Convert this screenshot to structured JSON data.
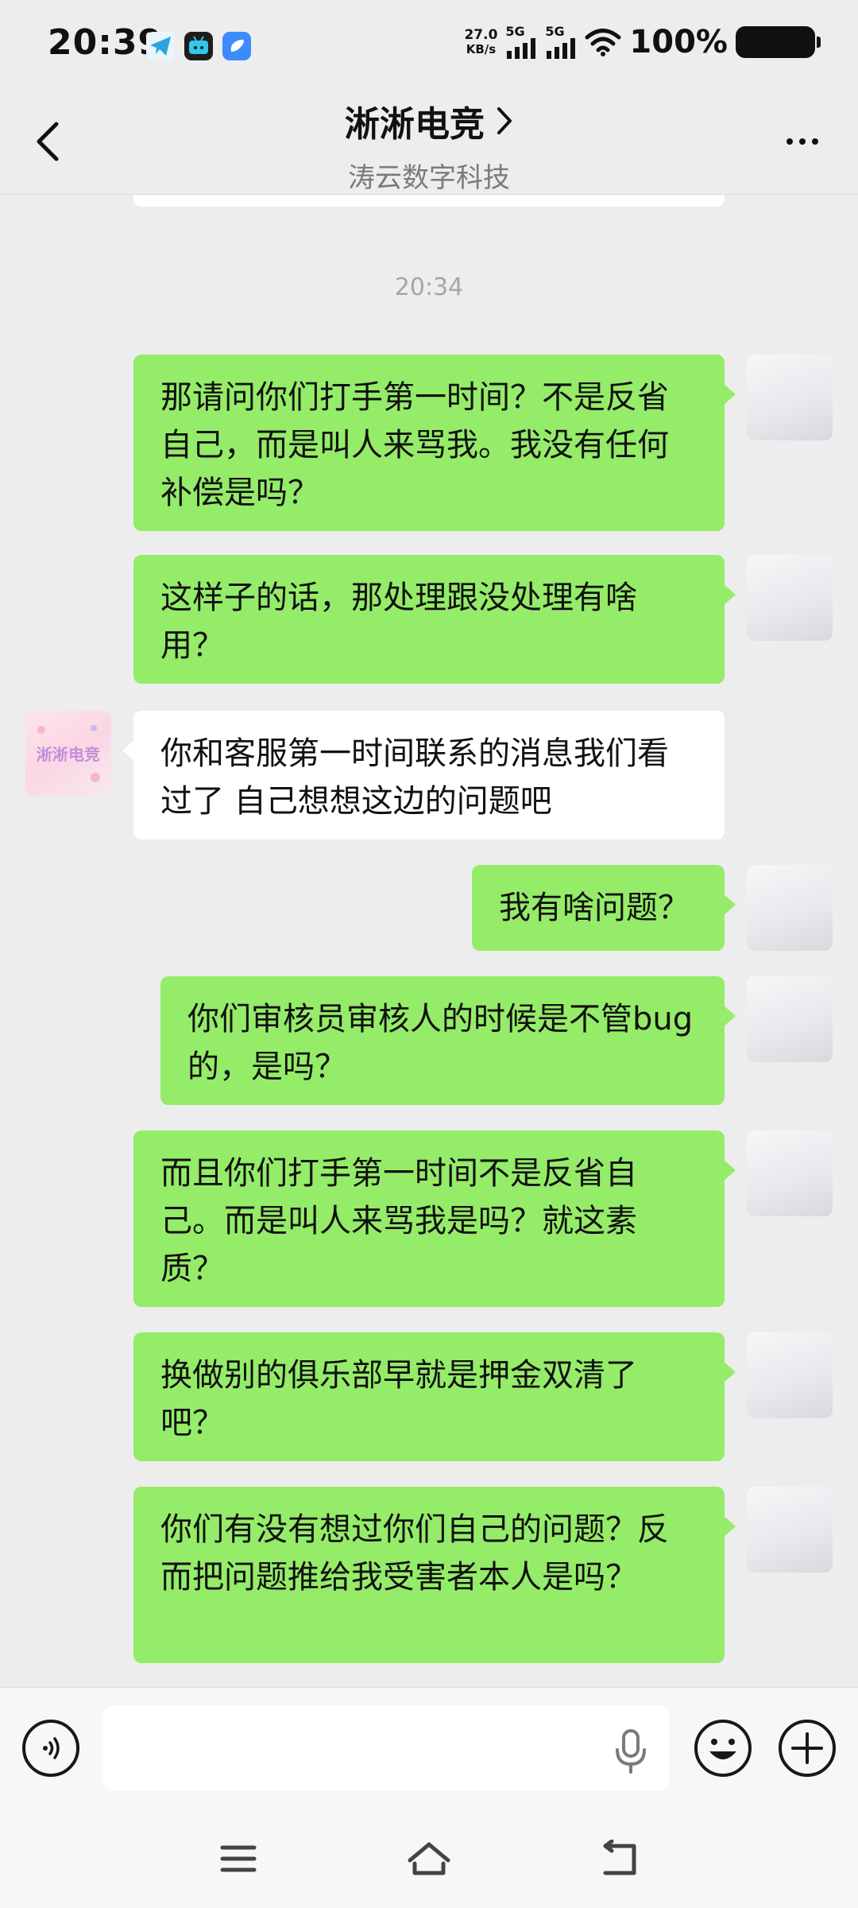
{
  "status_bar": {
    "time": "20:39",
    "net_speed_value": "27.0",
    "net_speed_unit": "KB/s",
    "sim1_tag": "5G",
    "sim2_tag": "5G",
    "battery_percent": "100%",
    "app_icons": [
      "telegram-icon",
      "bilibili-icon",
      "blue-app-icon"
    ]
  },
  "header": {
    "title": "淅淅电竞",
    "subtitle": "涛云数字科技"
  },
  "chat": {
    "timestamp": "20:34",
    "shop_avatar_text": "淅淅电竞",
    "messages": [
      {
        "side": "out",
        "text": "那请问你们打手第一时间？不是反省自己，而是叫人来骂我。我没有任何补偿是吗？"
      },
      {
        "side": "out",
        "text": "这样子的话，那处理跟没处理有啥用？"
      },
      {
        "side": "in",
        "text": "你和客服第一时间联系的消息我们看过了 自己想想这边的问题吧"
      },
      {
        "side": "out",
        "text": "我有啥问题？"
      },
      {
        "side": "out",
        "text": "你们审核员审核人的时候是不管bug的，是吗？"
      },
      {
        "side": "out",
        "text": "而且你们打手第一时间不是反省自己。而是叫人来骂我是吗？就这素质？"
      },
      {
        "side": "out",
        "text": "换做别的俱乐部早就是押金双清了吧？"
      },
      {
        "side": "out",
        "text": "你们有没有想过你们自己的问题？反而把问题推给我受害者本人是吗？"
      }
    ]
  },
  "input_bar": {
    "input_value": "",
    "voice_icon": "voice-wave-icon",
    "mic_icon": "microphone-icon",
    "emoji_icon": "emoji-icon",
    "plus_icon": "plus-icon"
  },
  "nav_bar": {
    "icons": [
      "menu-icon",
      "home-icon",
      "back-icon"
    ]
  },
  "colors": {
    "outgoing_bubble": "#95ec69",
    "incoming_bubble": "#ffffff",
    "background": "#ededed"
  }
}
